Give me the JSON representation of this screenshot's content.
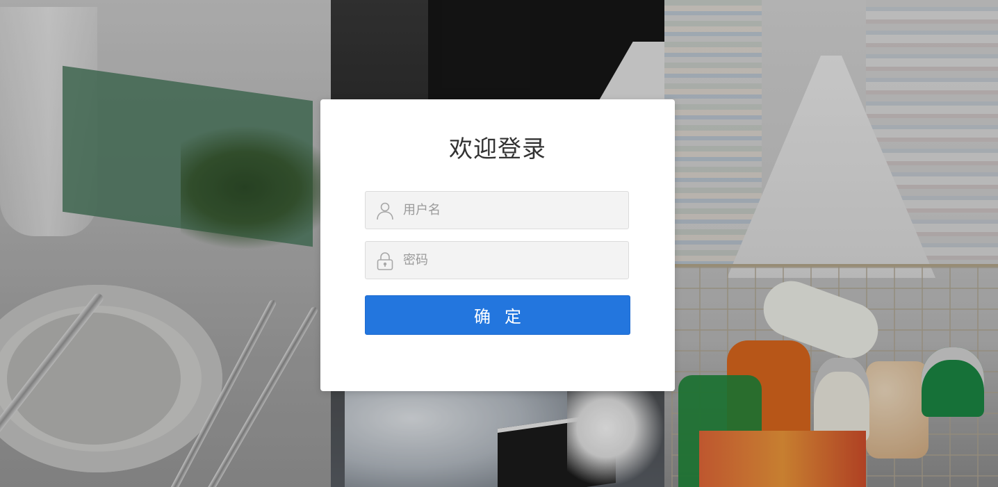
{
  "login": {
    "title": "欢迎登录",
    "username_placeholder": "用户名",
    "password_placeholder": "密码",
    "submit_label": "确定"
  },
  "icons": {
    "username": "user-icon",
    "password": "lock-icon"
  },
  "colors": {
    "primary_button": "#2376de",
    "card_background": "#ffffff",
    "input_background": "#f3f3f3",
    "title_text": "#333333",
    "placeholder_text": "#9a9a9a"
  }
}
